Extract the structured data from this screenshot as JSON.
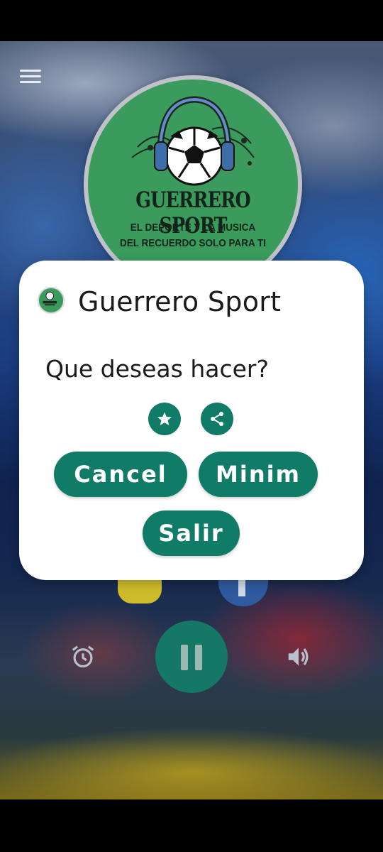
{
  "app": {
    "name": "Guerrero Sport",
    "logo_title": "GUERRERO SPORT",
    "logo_tagline_1": "EL DEPORTE Y LA MUSICA",
    "logo_tagline_2": "DEL RECUERDO SOLO PARA TI"
  },
  "dialog": {
    "title": "Guerrero Sport",
    "message": "Que deseas hacer?",
    "icon_buttons": [
      {
        "icon": "star-icon"
      },
      {
        "icon": "share-icon"
      }
    ],
    "buttons": {
      "cancel": "Cancel",
      "minimize": "Minim",
      "exit": "Salir"
    }
  },
  "player": {
    "state": "playing",
    "controls": [
      "alarm-icon",
      "pause-icon",
      "volume-icon"
    ]
  },
  "colors": {
    "accent": "#107c68",
    "logo_green": "#3a9b5d",
    "dialog_bg": "#ffffff"
  }
}
